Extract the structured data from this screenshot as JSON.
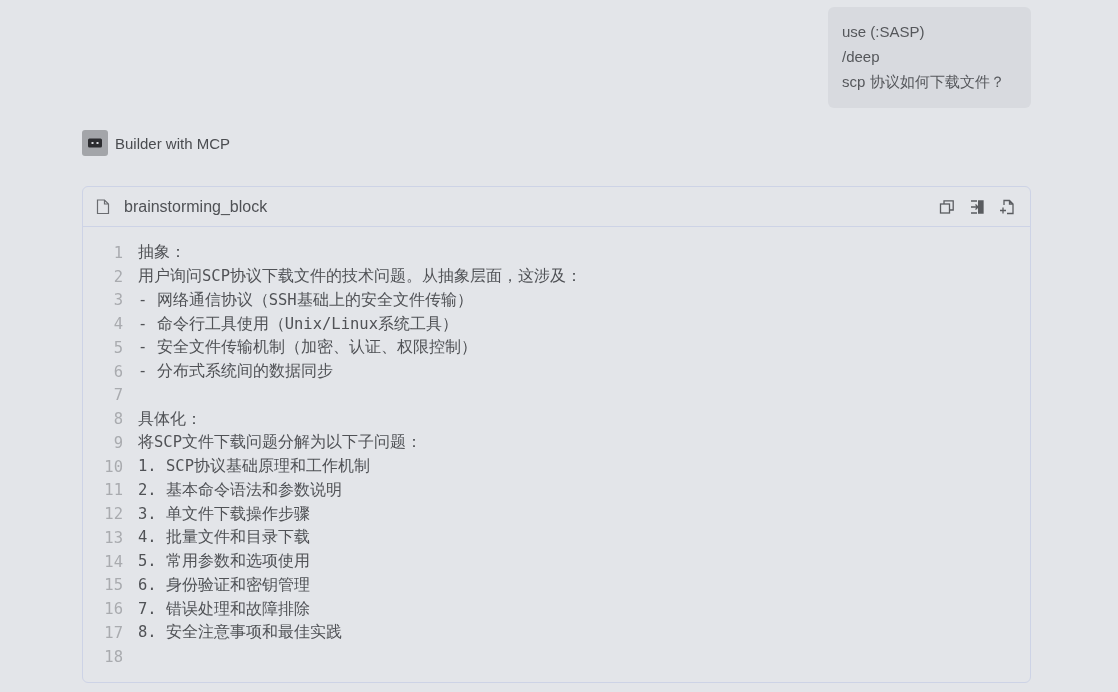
{
  "user_message": {
    "lines": [
      "use (:SASP)",
      "/deep",
      "scp 协议如何下载文件？"
    ]
  },
  "agent": {
    "name": "Builder with MCP"
  },
  "code_block": {
    "filename": "brainstorming_block",
    "lines": [
      {
        "number": "1",
        "text": "抽象："
      },
      {
        "number": "2",
        "text": "用户询问SCP协议下载文件的技术问题。从抽象层面，这涉及："
      },
      {
        "number": "3",
        "text": "- 网络通信协议（SSH基础上的安全文件传输）"
      },
      {
        "number": "4",
        "text": "- 命令行工具使用（Unix/Linux系统工具）"
      },
      {
        "number": "5",
        "text": "- 安全文件传输机制（加密、认证、权限控制）"
      },
      {
        "number": "6",
        "text": "- 分布式系统间的数据同步"
      },
      {
        "number": "7"
      },
      {
        "number": "8",
        "text": "具体化："
      },
      {
        "number": "9",
        "text": "将SCP文件下载问题分解为以下子问题："
      },
      {
        "number": "10",
        "text": "1. SCP协议基础原理和工作机制"
      },
      {
        "number": "11",
        "text": "2. 基本命令语法和参数说明"
      },
      {
        "number": "12",
        "text": "3. 单文件下载操作步骤"
      },
      {
        "number": "13",
        "text": "4. 批量文件和目录下载"
      },
      {
        "number": "14",
        "text": "5. 常用参数和选项使用"
      },
      {
        "number": "15",
        "text": "6. 身份验证和密钥管理"
      },
      {
        "number": "16",
        "text": "7. 错误处理和故障排除"
      },
      {
        "number": "17",
        "text": "8. 安全注意事项和最佳实践"
      },
      {
        "number": "18"
      }
    ]
  }
}
